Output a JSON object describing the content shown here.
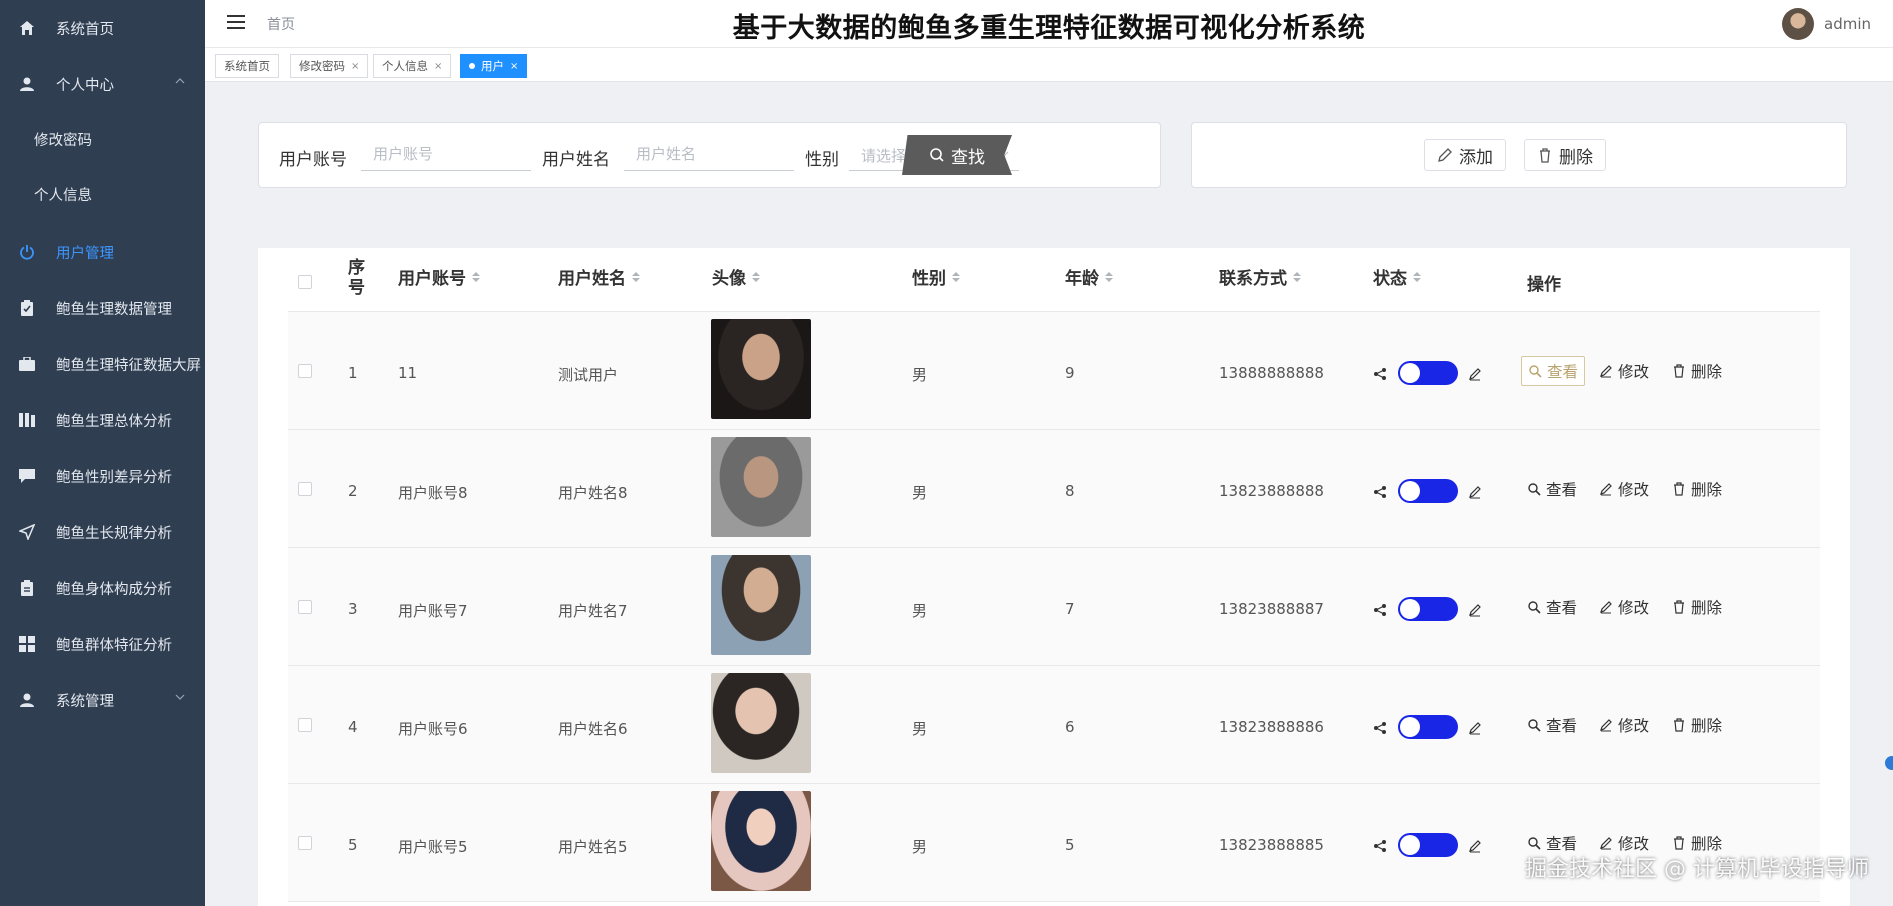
{
  "app": {
    "title": "基于大数据的鲍鱼多重生理特征数据可视化分析系统",
    "breadcrumb": "首页",
    "user": "admin",
    "watermark": "掘金技术社区 @ 计算机毕设指导师"
  },
  "sidebar": {
    "items": [
      {
        "label": "系统首页",
        "icon": "home-icon"
      },
      {
        "label": "个人中心",
        "icon": "user-icon"
      },
      {
        "label": "修改密码",
        "icon": ""
      },
      {
        "label": "个人信息",
        "icon": ""
      },
      {
        "label": "用户管理",
        "icon": "power-icon"
      },
      {
        "label": "鲍鱼生理数据管理",
        "icon": "clipboard-icon"
      },
      {
        "label": "鲍鱼生理特征数据大屏",
        "icon": "briefcase-icon"
      },
      {
        "label": "鲍鱼生理总体分析",
        "icon": "book-icon"
      },
      {
        "label": "鲍鱼性别差异分析",
        "icon": "chat-icon"
      },
      {
        "label": "鲍鱼生长规律分析",
        "icon": "send-icon"
      },
      {
        "label": "鲍鱼身体构成分析",
        "icon": "clipboard-icon"
      },
      {
        "label": "鲍鱼群体特征分析",
        "icon": "grid-icon"
      },
      {
        "label": "系统管理",
        "icon": "user-icon"
      }
    ],
    "active": "用户管理"
  },
  "tabs": [
    {
      "label": "系统首页"
    },
    {
      "label": "修改密码"
    },
    {
      "label": "个人信息"
    },
    {
      "label": "用户"
    }
  ],
  "search": {
    "account_label": "用户账号",
    "account_placeholder": "用户账号",
    "name_label": "用户姓名",
    "name_placeholder": "用户姓名",
    "gender_label": "性别",
    "gender_placeholder": "请选择性别",
    "search_btn": "查找"
  },
  "toolbar": {
    "add": "添加",
    "delete": "删除"
  },
  "table": {
    "columns": [
      "序号",
      "用户账号",
      "用户姓名",
      "头像",
      "性别",
      "年龄",
      "联系方式",
      "状态",
      "操作"
    ],
    "actions": {
      "view": "查看",
      "edit": "修改",
      "delete": "删除"
    },
    "rows": [
      {
        "no": "1",
        "account": "11",
        "name": "测试用户",
        "gender": "男",
        "age": "9",
        "phone": "13888888888"
      },
      {
        "no": "2",
        "account": "用户账号8",
        "name": "用户姓名8",
        "gender": "男",
        "age": "8",
        "phone": "13823888888"
      },
      {
        "no": "3",
        "account": "用户账号7",
        "name": "用户姓名7",
        "gender": "男",
        "age": "7",
        "phone": "13823888887"
      },
      {
        "no": "4",
        "account": "用户账号6",
        "name": "用户姓名6",
        "gender": "男",
        "age": "6",
        "phone": "13823888886"
      },
      {
        "no": "5",
        "account": "用户账号5",
        "name": "用户姓名5",
        "gender": "男",
        "age": "5",
        "phone": "13823888885"
      }
    ]
  },
  "colors": {
    "sidebar_bg": "#2f3e51",
    "active": "#3c96ff",
    "switch_on": "#1a26e6",
    "search_btn": "#5b5b5b"
  }
}
